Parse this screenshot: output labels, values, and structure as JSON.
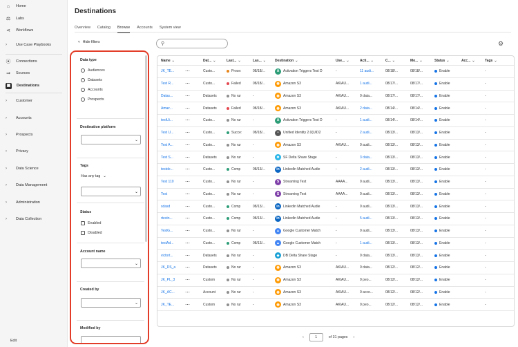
{
  "nav": {
    "top": [
      {
        "icon": "home-icon",
        "label": "Home"
      },
      {
        "icon": "labs-icon",
        "label": "Labs"
      },
      {
        "icon": "workflows-icon",
        "label": "Workflows"
      },
      {
        "chevron": true,
        "label": "Use Case Playbooks"
      }
    ],
    "mid": [
      {
        "icon": "connections-icon",
        "label": "Connections"
      },
      {
        "icon": "sources-icon",
        "label": "Sources"
      },
      {
        "icon": "destinations-icon",
        "label": "Destinations",
        "active": true
      }
    ],
    "groups": [
      "Customer",
      "Accounts",
      "Prospects",
      "Privacy",
      "Data Science",
      "Data Management",
      "Administration",
      "Data Collection"
    ],
    "edit_label": "Edit"
  },
  "page": {
    "title": "Destinations"
  },
  "tabs": [
    "Overview",
    "Catalog",
    "Browse",
    "Accounts",
    "System view"
  ],
  "selected_tab": "Browse",
  "toolbar": {
    "hide_filters": "Hide filters",
    "search_placeholder": ""
  },
  "filters": {
    "data_type": {
      "title": "Data type",
      "options": [
        "Audiences",
        "Datasets",
        "Accounts",
        "Prospects"
      ]
    },
    "destination_platform": {
      "title": "Destination platform"
    },
    "tags": {
      "title": "Tags",
      "mode": "Has any tag"
    },
    "status": {
      "title": "Status",
      "options": [
        "Enabled",
        "Disabled"
      ]
    },
    "account_name": {
      "title": "Account name"
    },
    "created_by": {
      "title": "Created by"
    },
    "modified_by": {
      "title": "Modified by"
    }
  },
  "table": {
    "headers": [
      "Name",
      "",
      "Dat...",
      "Last...",
      "Las...",
      "Destination",
      "Use...",
      "Acti...",
      "C...",
      "Mo...",
      "Status",
      "Acc...",
      "Tags"
    ],
    "rows": [
      {
        "name": "JK_TE...",
        "data": "Custo...",
        "last_status": "Proce:",
        "status_color": "#e68619",
        "last_date": "08/18/...",
        "dest": "Activation Triggers Test D",
        "dicon": "triggers",
        "user": "-",
        "act": "11 audi...",
        "act_link": true,
        "created": "08/18/...",
        "modified": "08/18/...",
        "status": "Enable",
        "acc": "",
        "tags": "-"
      },
      {
        "name": "Test R...",
        "data": "Custo...",
        "last_status": "Failed",
        "status_color": "#e34850",
        "last_date": "08/18/...",
        "dest": "Amazon S3",
        "dicon": "s3",
        "user": "AKIAU...",
        "act": "1 audi...",
        "act_link": true,
        "created": "08/17/...",
        "modified": "08/17/...",
        "status": "Enable",
        "acc": "",
        "tags": "-"
      },
      {
        "name": "Datas...",
        "data": "Datasets",
        "last_status": "No rur",
        "status_color": "#8e8e8e",
        "last_date": "-",
        "dest": "Amazon S3",
        "dicon": "s3",
        "user": "AKIAU...",
        "act": "0 data...",
        "act_link": false,
        "created": "08/17/...",
        "modified": "08/17/...",
        "status": "Enable",
        "acc": "",
        "tags": "-"
      },
      {
        "name": "Amaz...",
        "data": "Datasets",
        "last_status": "Failed",
        "status_color": "#e34850",
        "last_date": "08/18/...",
        "dest": "Amazon S3",
        "dicon": "s3",
        "user": "AKIAU...",
        "act": "2 data...",
        "act_link": true,
        "created": "08/14/...",
        "modified": "08/14/...",
        "status": "Enable",
        "acc": "",
        "tags": "-"
      },
      {
        "name": "testUi...",
        "data": "Custo...",
        "last_status": "No rur",
        "status_color": "#8e8e8e",
        "last_date": "-",
        "dest": "Activation Triggers Test D",
        "dicon": "triggers",
        "user": "-",
        "act": "1 audi...",
        "act_link": true,
        "created": "08/14/...",
        "modified": "08/14/...",
        "status": "Enable",
        "acc": "",
        "tags": "-"
      },
      {
        "name": "Test U...",
        "data": "Custo...",
        "last_status": "Succe:",
        "status_color": "#2d9d78",
        "last_date": "08/18/...",
        "dest": "Unified Identity 2.0(UID2",
        "dicon": "uid2",
        "user": "-",
        "act": "2 audi...",
        "act_link": true,
        "created": "08/13/...",
        "modified": "08/13/...",
        "status": "Enable",
        "acc": "",
        "tags": "-"
      },
      {
        "name": "Test A...",
        "data": "Custo...",
        "last_status": "No rur",
        "status_color": "#8e8e8e",
        "last_date": "-",
        "dest": "Amazon S3",
        "dicon": "s3",
        "user": "AKIAU...",
        "act": "0 audi...",
        "act_link": false,
        "created": "08/13/...",
        "modified": "08/13/...",
        "status": "Enable",
        "acc": "",
        "tags": "-"
      },
      {
        "name": "Test S...",
        "data": "Datasets",
        "last_status": "No rur",
        "status_color": "#8e8e8e",
        "last_date": "-",
        "dest": "SF Delta Share Stage",
        "dicon": "sf",
        "user": "-",
        "act": "3 data...",
        "act_link": true,
        "created": "08/13/...",
        "modified": "08/13/...",
        "status": "Enable",
        "acc": "",
        "tags": "-"
      },
      {
        "name": "testde...",
        "data": "Custo...",
        "last_status": "Comp",
        "status_color": "#2d9d78",
        "last_date": "08/13/...",
        "dest": "LinkedIn Matched Audie",
        "dicon": "linkedin",
        "user": "-",
        "act": "2 audi...",
        "act_link": true,
        "created": "08/13/...",
        "modified": "08/13/...",
        "status": "Enable",
        "acc": "",
        "tags": "-"
      },
      {
        "name": "Test 110",
        "data": "Custo...",
        "last_status": "No rur",
        "status_color": "#8e8e8e",
        "last_date": "-",
        "dest": "Streaming Test",
        "dicon": "streaming",
        "user": "AAAA...",
        "act": "0 audi...",
        "act_link": false,
        "created": "08/13/...",
        "modified": "08/13/...",
        "status": "Enable",
        "acc": "",
        "tags": "-"
      },
      {
        "name": "Test",
        "data": "Custo...",
        "last_status": "No rur",
        "status_color": "#8e8e8e",
        "last_date": "-",
        "dest": "Streaming Test",
        "dicon": "streaming",
        "user": "AAAA...",
        "act": "0 audi...",
        "act_link": false,
        "created": "08/13/...",
        "modified": "08/13/...",
        "status": "Enable",
        "acc": "",
        "tags": "-"
      },
      {
        "name": "sdasd",
        "data": "Custo...",
        "last_status": "Comp",
        "status_color": "#2d9d78",
        "last_date": "08/13/...",
        "dest": "LinkedIn Matched Audie",
        "dicon": "linkedin",
        "user": "-",
        "act": "0 audi...",
        "act_link": false,
        "created": "08/13/...",
        "modified": "08/13/...",
        "status": "Enable",
        "acc": "",
        "tags": "-"
      },
      {
        "name": "rtestn...",
        "data": "Custo...",
        "last_status": "Comp",
        "status_color": "#2d9d78",
        "last_date": "08/13/...",
        "dest": "LinkedIn Matched Audie",
        "dicon": "linkedin",
        "user": "-",
        "act": "5 audi...",
        "act_link": true,
        "created": "08/13/...",
        "modified": "08/13/...",
        "status": "Enable",
        "acc": "",
        "tags": "-"
      },
      {
        "name": "TestG...",
        "data": "Custo...",
        "last_status": "No rur",
        "status_color": "#8e8e8e",
        "last_date": "-",
        "dest": "Google Customer Match",
        "dicon": "google",
        "user": "-",
        "act": "0 audi...",
        "act_link": false,
        "created": "08/13/...",
        "modified": "08/13/...",
        "status": "Enable",
        "acc": "",
        "tags": "-"
      },
      {
        "name": "testAd...",
        "data": "Custo...",
        "last_status": "Comp",
        "status_color": "#2d9d78",
        "last_date": "08/13/...",
        "dest": "Google Customer Match",
        "dicon": "google",
        "user": "-",
        "act": "1 audi...",
        "act_link": true,
        "created": "08/13/...",
        "modified": "08/13/...",
        "status": "Enable",
        "acc": "",
        "tags": "-"
      },
      {
        "name": "victort...",
        "data": "Datasets",
        "last_status": "No rur",
        "status_color": "#8e8e8e",
        "last_date": "-",
        "dest": "DB Delta Share Stage",
        "dicon": "db",
        "user": "-",
        "act": "0 data...",
        "act_link": false,
        "created": "08/13/...",
        "modified": "08/13/...",
        "status": "Enable",
        "acc": "",
        "tags": "-"
      },
      {
        "name": "JK_DS_a",
        "data": "Datasets",
        "last_status": "No rur",
        "status_color": "#8e8e8e",
        "last_date": "-",
        "dest": "Amazon S3",
        "dicon": "s3",
        "user": "AKIAU...",
        "act": "0 data...",
        "act_link": false,
        "created": "08/12/...",
        "modified": "08/12/...",
        "status": "Enable",
        "acc": "",
        "tags": "-"
      },
      {
        "name": "JK_PL_3",
        "data": "Custom",
        "last_status": "No rur",
        "status_color": "#8e8e8e",
        "last_date": "-",
        "dest": "Amazon S3",
        "dicon": "s3",
        "user": "AKIAU...",
        "act": "0 peo...",
        "act_link": false,
        "created": "08/12/...",
        "modified": "08/12/...",
        "status": "Enable",
        "acc": "",
        "tags": "-"
      },
      {
        "name": "JK_AC...",
        "data": "Account",
        "last_status": "No rur",
        "status_color": "#8e8e8e",
        "last_date": "-",
        "dest": "Amazon S3",
        "dicon": "s3",
        "user": "AKIAU...",
        "act": "0 acco...",
        "act_link": false,
        "created": "08/12/...",
        "modified": "08/12/...",
        "status": "Enable",
        "acc": "",
        "tags": "-"
      },
      {
        "name": "JK_TE...",
        "data": "Custom",
        "last_status": "No rur",
        "status_color": "#8e8e8e",
        "last_date": "-",
        "dest": "Amazon S3",
        "dicon": "s3",
        "user": "AKIAU...",
        "act": "0 peo...",
        "act_link": false,
        "created": "08/12/...",
        "modified": "08/12/...",
        "status": "Enable",
        "acc": "",
        "tags": "-"
      }
    ]
  },
  "pagination": {
    "page": "1",
    "of": "of 31 pages"
  },
  "colors": {
    "accent": "#1473e6",
    "enabled": "#1473e6",
    "highlight": "#e23d28"
  }
}
